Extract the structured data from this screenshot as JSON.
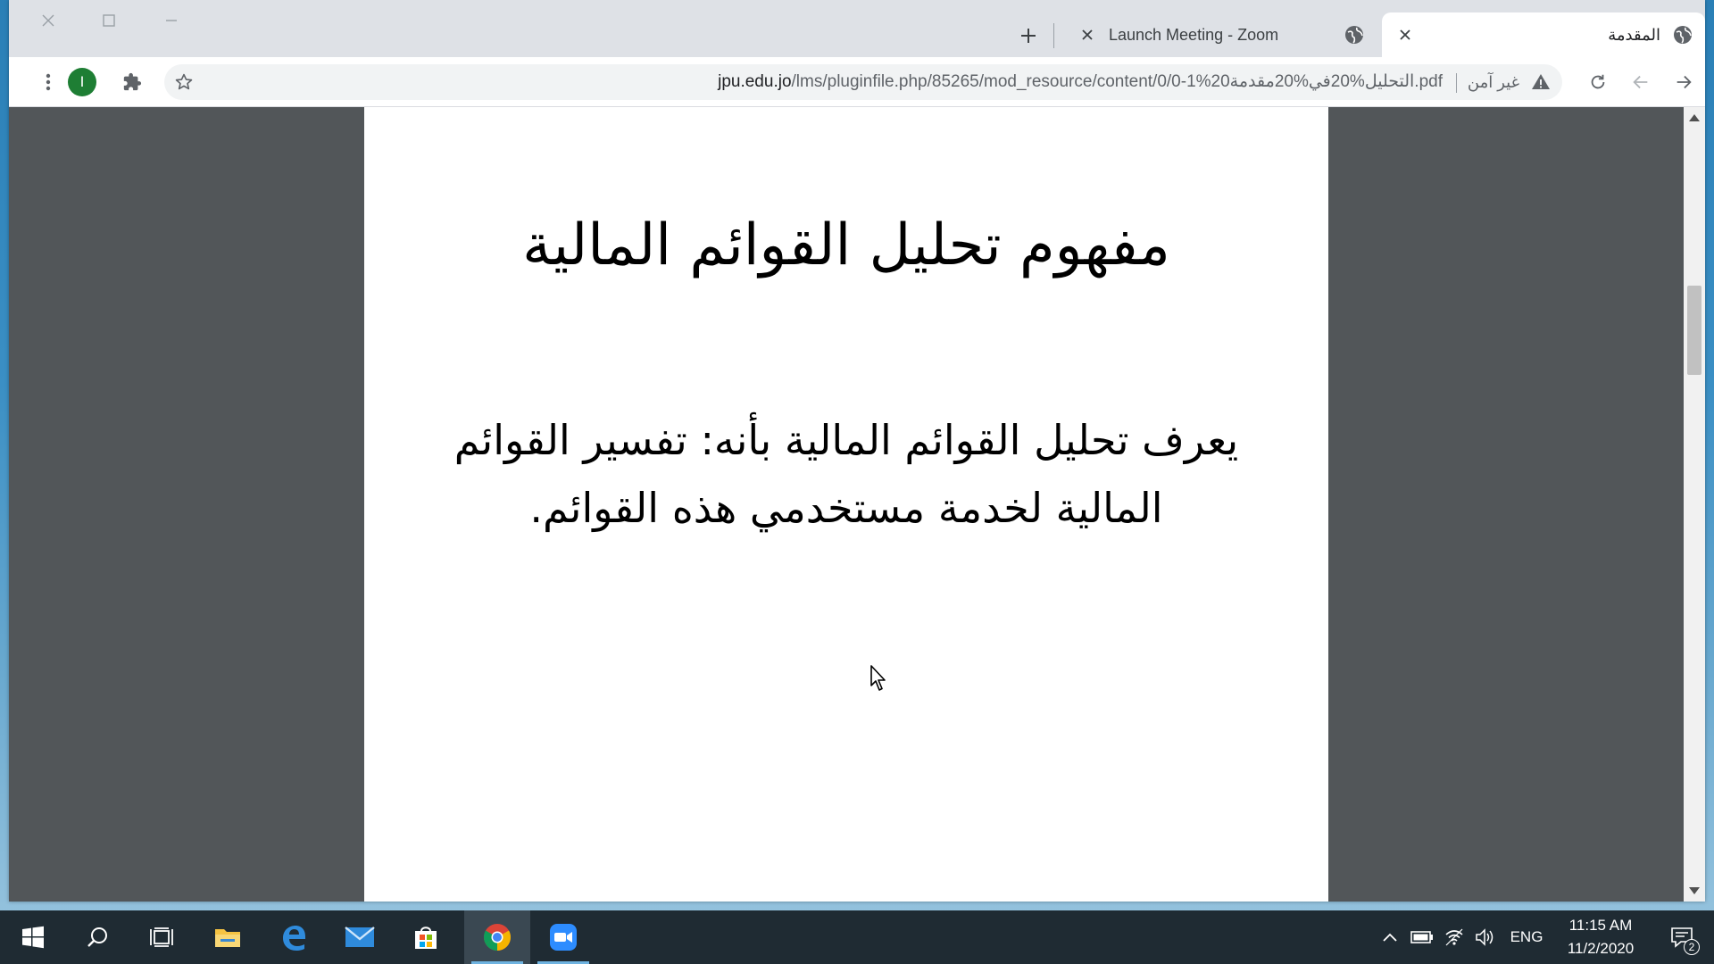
{
  "browser": {
    "tabs": [
      {
        "title": "Launch Meeting - Zoom",
        "favicon": "globe-icon",
        "active": false
      },
      {
        "title": "المقدمة",
        "favicon": "globe-icon",
        "active": true
      }
    ],
    "profile_initial": "I",
    "address": {
      "host": "jpu.edu.jo",
      "path": "/lms/pluginfile.php/85265/mod_resource/content/0/0-1%20التحليل%20في%20مقدمة.pdf",
      "security_label": "غير آمن"
    }
  },
  "pdf": {
    "title": "مفهوم تحليل القوائم المالية",
    "body": "يعرف تحليل القوائم المالية بأنه: تفسير القوائم المالية لخدمة مستخدمي هذه القوائم."
  },
  "taskbar": {
    "apps": [
      "windows-start",
      "search",
      "task-view",
      "file-explorer",
      "edge",
      "mail",
      "store",
      "chrome",
      "zoom"
    ],
    "language": "ENG",
    "time": "11:15 AM",
    "date": "11/2/2020",
    "notification_count": "2"
  },
  "colors": {
    "viewer_bg": "#525659",
    "tabstrip_bg": "#dee1e6",
    "taskbar_bg": "#1f2b33",
    "profile_bg": "#1e7e34"
  }
}
